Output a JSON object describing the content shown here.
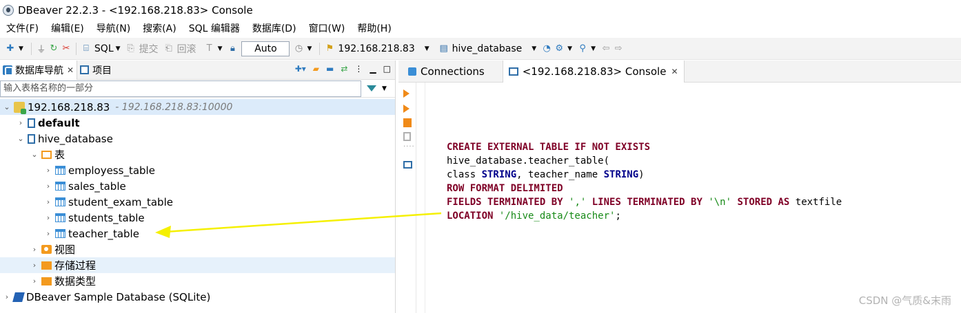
{
  "window": {
    "title": "DBeaver 22.2.3 - <192.168.218.83> Console"
  },
  "menu": [
    "文件(F)",
    "编辑(E)",
    "导航(N)",
    "搜索(A)",
    "SQL 编辑器",
    "数据库(D)",
    "窗口(W)",
    "帮助(H)"
  ],
  "toolbar": {
    "sql_label": "SQL",
    "commit_label": "提交",
    "rollback_label": "回滚",
    "auto_label": "Auto",
    "connection_label": "192.168.218.83",
    "database_label": "hive_database"
  },
  "left_panel": {
    "tabs": [
      {
        "label": "数据库导航",
        "active": true
      },
      {
        "label": "项目",
        "active": false
      }
    ],
    "filter_placeholder": "输入表格名称的一部分"
  },
  "tree": {
    "connection": {
      "label": "192.168.218.83",
      "sublabel": "- 192.168.218.83:10000"
    },
    "default_db": "default",
    "hive_db": "hive_database",
    "tables_folder": "表",
    "tables": [
      "employess_table",
      "sales_table",
      "student_exam_table",
      "students_table",
      "teacher_table"
    ],
    "views_folder": "视图",
    "procedures_folder": "存储过程",
    "datatypes_folder": "数据类型",
    "sample_db": "DBeaver Sample Database (SQLite)"
  },
  "editor_tabs": [
    {
      "label": "Connections",
      "active": false
    },
    {
      "label": "<192.168.218.83> Console",
      "active": true
    }
  ],
  "code": {
    "l1_kw": "CREATE EXTERNAL TABLE IF NOT EXISTS",
    "l2": "hive_database.teacher_table(",
    "l3_a": "class ",
    "l3_b": "STRING",
    "l3_c": ", teacher_name ",
    "l3_d": "STRING",
    "l3_e": ")",
    "l4_kw": "ROW FORMAT DELIMITED",
    "l5_a": "FIELDS TERMINATED BY ",
    "l5_b": "','",
    "l5_c": " LINES TERMINATED BY ",
    "l5_d": "'\\n'",
    "l5_e": " STORED AS ",
    "l5_f": "textfile",
    "l6_a": "LOCATION ",
    "l6_b": "'/hive_data/teacher'",
    "l6_c": ";"
  },
  "watermark": "CSDN @气质&末雨",
  "colors": {
    "keyword": "#7f0026",
    "type": "#00008b",
    "string": "#178a17",
    "arrow": "#f5f000",
    "selection": "#dcebfa"
  }
}
